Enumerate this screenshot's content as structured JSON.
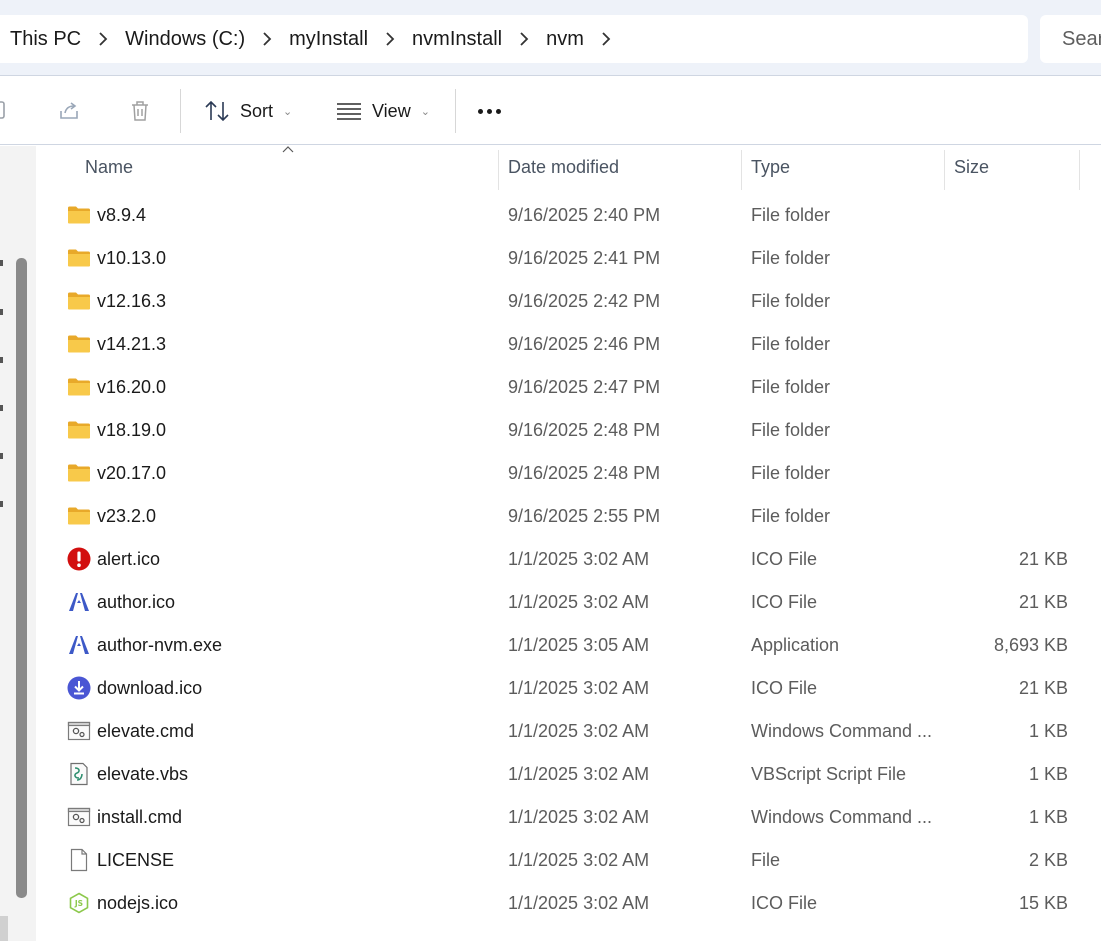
{
  "breadcrumb": [
    "This PC",
    "Windows (C:)",
    "myInstall",
    "nvmInstall",
    "nvm"
  ],
  "search": {
    "placeholder": "Search"
  },
  "toolbar": {
    "sort_label": "Sort",
    "view_label": "View"
  },
  "columns": {
    "name": "Name",
    "date": "Date modified",
    "type": "Type",
    "size": "Size"
  },
  "files": [
    {
      "name": "v8.9.4",
      "date": "9/16/2025 2:40 PM",
      "type": "File folder",
      "size": "",
      "icon": "folder-icon"
    },
    {
      "name": "v10.13.0",
      "date": "9/16/2025 2:41 PM",
      "type": "File folder",
      "size": "",
      "icon": "folder-icon"
    },
    {
      "name": "v12.16.3",
      "date": "9/16/2025 2:42 PM",
      "type": "File folder",
      "size": "",
      "icon": "folder-icon"
    },
    {
      "name": "v14.21.3",
      "date": "9/16/2025 2:46 PM",
      "type": "File folder",
      "size": "",
      "icon": "folder-icon"
    },
    {
      "name": "v16.20.0",
      "date": "9/16/2025 2:47 PM",
      "type": "File folder",
      "size": "",
      "icon": "folder-icon"
    },
    {
      "name": "v18.19.0",
      "date": "9/16/2025 2:48 PM",
      "type": "File folder",
      "size": "",
      "icon": "folder-icon"
    },
    {
      "name": "v20.17.0",
      "date": "9/16/2025 2:48 PM",
      "type": "File folder",
      "size": "",
      "icon": "folder-icon"
    },
    {
      "name": "v23.2.0",
      "date": "9/16/2025 2:55 PM",
      "type": "File folder",
      "size": "",
      "icon": "folder-icon"
    },
    {
      "name": "alert.ico",
      "date": "1/1/2025 3:02 AM",
      "type": "ICO File",
      "size": "21 KB",
      "icon": "alert-icon"
    },
    {
      "name": "author.ico",
      "date": "1/1/2025 3:02 AM",
      "type": "ICO File",
      "size": "21 KB",
      "icon": "author-icon"
    },
    {
      "name": "author-nvm.exe",
      "date": "1/1/2025 3:05 AM",
      "type": "Application",
      "size": "8,693 KB",
      "icon": "author-icon"
    },
    {
      "name": "download.ico",
      "date": "1/1/2025 3:02 AM",
      "type": "ICO File",
      "size": "21 KB",
      "icon": "download-icon"
    },
    {
      "name": "elevate.cmd",
      "date": "1/1/2025 3:02 AM",
      "type": "Windows Command ...",
      "size": "1 KB",
      "icon": "cmd-file-icon"
    },
    {
      "name": "elevate.vbs",
      "date": "1/1/2025 3:02 AM",
      "type": "VBScript Script File",
      "size": "1 KB",
      "icon": "script-file-icon"
    },
    {
      "name": "install.cmd",
      "date": "1/1/2025 3:02 AM",
      "type": "Windows Command ...",
      "size": "1 KB",
      "icon": "cmd-file-icon"
    },
    {
      "name": "LICENSE",
      "date": "1/1/2025 3:02 AM",
      "type": "File",
      "size": "2 KB",
      "icon": "blank-file-icon"
    },
    {
      "name": "nodejs.ico",
      "date": "1/1/2025 3:02 AM",
      "type": "ICO File",
      "size": "15 KB",
      "icon": "nodejs-icon"
    }
  ],
  "colors": {
    "folder": "#f8c94a",
    "alert": "#d20f0f",
    "author": "#3d59c7",
    "download": "#4a56d4",
    "nodejs": "#8cc84b",
    "sort_caret": "#5a5a5a"
  }
}
